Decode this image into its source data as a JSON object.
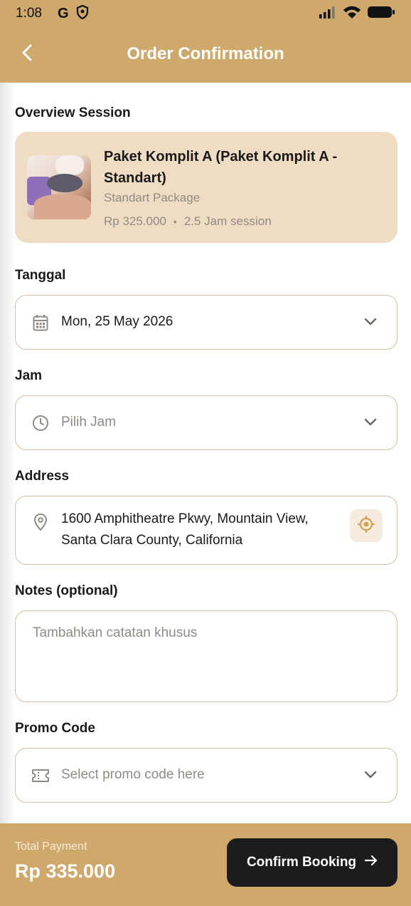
{
  "status_bar": {
    "time": "1:08",
    "g_label": "G"
  },
  "header": {
    "title": "Order Confirmation"
  },
  "overview": {
    "section_label": "Overview Session",
    "package_name": "Paket Komplit A (Paket Komplit A - Standart)",
    "package_type": "Standart Package",
    "price": "Rp 325.000",
    "separator": "•",
    "duration": "2.5 Jam session"
  },
  "date_field": {
    "label": "Tanggal",
    "value": "Mon, 25 May 2026"
  },
  "time_field": {
    "label": "Jam",
    "placeholder": "Pilih Jam"
  },
  "address_field": {
    "label": "Address",
    "line1": "1600 Amphitheatre Pkwy, Mountain View,",
    "line2": "Santa Clara County, California"
  },
  "notes_field": {
    "label": "Notes (optional)",
    "placeholder": "Tambahkan catatan khusus"
  },
  "promo_field": {
    "label": "Promo Code",
    "placeholder": "Select promo code here"
  },
  "footer": {
    "total_label": "Total Payment",
    "total_value": "Rp 335.000",
    "confirm_label": "Confirm Booking"
  },
  "colors": {
    "brand": "#cfa86b",
    "card_bg": "#efdcc2",
    "field_border": "#d4bf9e",
    "button_bg": "#1c1c1c",
    "accent_icon": "#d4a050"
  },
  "icons": {
    "back": "back-arrow-icon",
    "date": "calendar-icon",
    "time": "clock-icon",
    "address": "map-pin-icon",
    "locate": "target-location-icon",
    "promo": "ticket-icon",
    "dropdown": "chevron-down-icon",
    "confirm": "arrow-right-icon"
  }
}
